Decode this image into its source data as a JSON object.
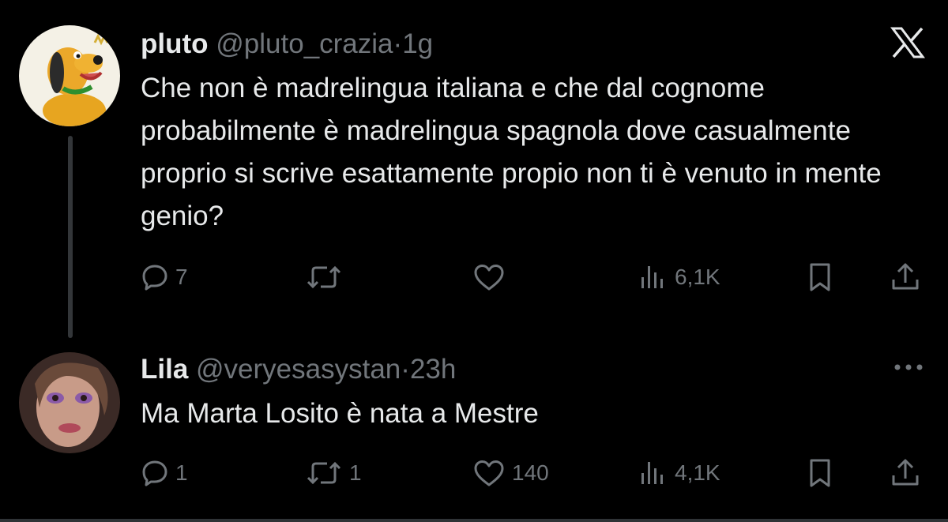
{
  "tweets": [
    {
      "name": "pluto",
      "handle": "@pluto_crazia",
      "separator": "·",
      "time": "1g",
      "text": "Che non è madrelingua italiana e che dal cognome probabilmente è madrelingua spagnola dove casualmente proprio si scrive esattamente propio non ti è venuto in mente genio?",
      "avatar_icon": "pluto-avatar",
      "stats": {
        "replies": "7",
        "retweets": "",
        "likes": "",
        "views": "6,1K"
      }
    },
    {
      "name": "Lila",
      "handle": "@veryesasystan",
      "separator": "·",
      "time": "23h",
      "text": "Ma Marta Losito è nata a Mestre",
      "avatar_icon": "user-photo-avatar",
      "stats": {
        "replies": "1",
        "retweets": "1",
        "likes": "140",
        "views": "4,1K"
      }
    }
  ],
  "top_right_icon": "x-logo-icon",
  "more_icon": "more-options-icon",
  "colors": {
    "background": "#000000",
    "text": "#e7e9ea",
    "secondary": "#71767b",
    "divider": "#2f3336"
  }
}
